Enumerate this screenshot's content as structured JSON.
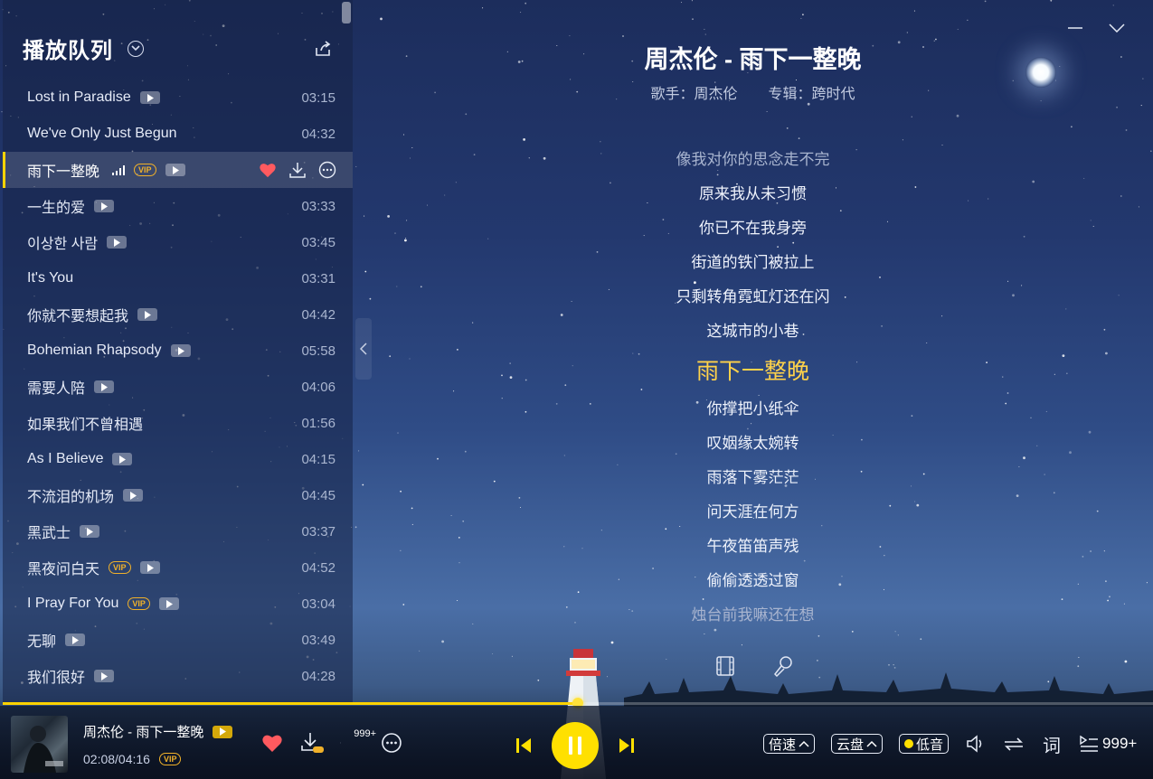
{
  "panel": {
    "title": "播放队列"
  },
  "songs": [
    {
      "title": "Lost in Paradise",
      "duration": "03:15",
      "vip": false
    },
    {
      "title": "We've Only Just Begun",
      "duration": "04:32",
      "vip": false,
      "no_badge": true
    },
    {
      "title": "雨下一整晚",
      "duration": "",
      "vip": true,
      "active": true
    },
    {
      "title": "一生的爱",
      "duration": "03:33",
      "vip": false
    },
    {
      "title": "이상한 사람",
      "duration": "03:45",
      "vip": false
    },
    {
      "title": "It's You",
      "duration": "03:31",
      "vip": false,
      "no_badge": true
    },
    {
      "title": "你就不要想起我",
      "duration": "04:42",
      "vip": false
    },
    {
      "title": "Bohemian Rhapsody",
      "duration": "05:58",
      "vip": false
    },
    {
      "title": "需要人陪",
      "duration": "04:06",
      "vip": false
    },
    {
      "title": "如果我们不曾相遇",
      "duration": "01:56",
      "vip": false,
      "no_badge": true
    },
    {
      "title": "As I Believe",
      "duration": "04:15",
      "vip": false
    },
    {
      "title": "不流泪的机场",
      "duration": "04:45",
      "vip": false
    },
    {
      "title": "黑武士",
      "duration": "03:37",
      "vip": false
    },
    {
      "title": "黑夜问白天",
      "duration": "04:52",
      "vip": true
    },
    {
      "title": "I Pray For You",
      "duration": "03:04",
      "vip": true
    },
    {
      "title": "无聊",
      "duration": "03:49",
      "vip": false
    },
    {
      "title": "我们很好",
      "duration": "04:28",
      "vip": false
    }
  ],
  "vip_label": "VIP",
  "now_playing": {
    "heading": "周杰伦 - 雨下一整晚",
    "singer_label": "歌手：周杰伦",
    "album_label": "专辑：跨时代",
    "bar_title": "周杰伦 - 雨下一整晚",
    "time": "02:08/04:16",
    "progress": 0.5,
    "comment_count": "999+"
  },
  "lyrics": [
    {
      "text": "像我对你的思念走不完",
      "state": "dim"
    },
    {
      "text": "原来我从未习惯",
      "state": "normal"
    },
    {
      "text": "你已不在我身旁",
      "state": "normal"
    },
    {
      "text": "街道的铁门被拉上",
      "state": "normal"
    },
    {
      "text": "只剩转角霓虹灯还在闪",
      "state": "normal"
    },
    {
      "text": "这城市的小巷",
      "state": "normal"
    },
    {
      "text": "雨下一整晚",
      "state": "current"
    },
    {
      "text": "你撑把小纸伞",
      "state": "normal"
    },
    {
      "text": "叹姻缘太婉转",
      "state": "normal"
    },
    {
      "text": "雨落下雾茫茫",
      "state": "normal"
    },
    {
      "text": "问天涯在何方",
      "state": "normal"
    },
    {
      "text": "午夜笛笛声残",
      "state": "normal"
    },
    {
      "text": "偷偷透透过窗",
      "state": "normal"
    },
    {
      "text": "烛台前我嘛还在想",
      "state": "dim"
    }
  ],
  "controls": {
    "speed_label": "倍速",
    "cloud_label": "云盘",
    "bass_label": "低音",
    "lyric_label": "词",
    "queue_count": "999+"
  },
  "icons": {
    "chevron": "chevron-down-icon",
    "share": "share-icon",
    "heart": "heart-icon",
    "download": "download-icon",
    "more": "more-icon",
    "mv": "film-icon",
    "mic": "microphone-icon"
  },
  "colors": {
    "accent": "#ffd300",
    "vip": "#f0b12a",
    "heart": "#ff5a5f",
    "current_lyric": "#ffd24a"
  }
}
